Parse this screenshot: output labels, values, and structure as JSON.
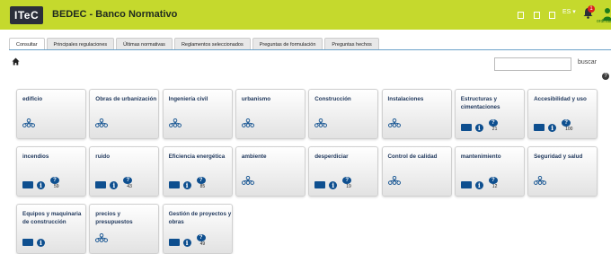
{
  "header": {
    "logo": "ITeC",
    "title": "BEDEC - Banco Normativo",
    "lang": "ES ▾",
    "notifications": "1",
    "user": "ordinatro"
  },
  "tabs": [
    {
      "label": "Consultar",
      "active": true
    },
    {
      "label": "Principales regulaciones",
      "active": false
    },
    {
      "label": "Últimas normativas",
      "active": false
    },
    {
      "label": "Reglamentos seleccionados",
      "active": false
    },
    {
      "label": "Preguntas de formulación",
      "active": false
    },
    {
      "label": "Preguntas hechos",
      "active": false
    }
  ],
  "search": {
    "placeholder": "",
    "button": "buscar"
  },
  "help": "?",
  "cards": [
    {
      "title": "edificio",
      "icons": [
        "network"
      ]
    },
    {
      "title": "Obras de urbanización",
      "icons": [
        "network"
      ]
    },
    {
      "title": "Ingeniería civil",
      "icons": [
        "network"
      ]
    },
    {
      "title": "urbanismo",
      "icons": [
        "network"
      ]
    },
    {
      "title": "Construcción",
      "icons": [
        "network"
      ]
    },
    {
      "title": "Instalaciones",
      "icons": [
        "network"
      ]
    },
    {
      "title": "Estructuras y cimentaciones",
      "icons": [
        "book",
        "info",
        "question"
      ],
      "count": "21"
    },
    {
      "title": "Accesibilidad y uso",
      "icons": [
        "book",
        "info",
        "question"
      ],
      "count": "100"
    },
    {
      "title": "incendios",
      "icons": [
        "book",
        "info",
        "question"
      ],
      "count": "59"
    },
    {
      "title": "ruido",
      "icons": [
        "book",
        "info",
        "question"
      ],
      "count": "43"
    },
    {
      "title": "Eficiencia energética",
      "icons": [
        "book",
        "info",
        "question"
      ],
      "count": "85"
    },
    {
      "title": "ambiente",
      "icons": [
        "network"
      ]
    },
    {
      "title": "desperdiciar",
      "icons": [
        "book",
        "info",
        "question"
      ],
      "count": "19"
    },
    {
      "title": "Control de calidad",
      "icons": [
        "network"
      ]
    },
    {
      "title": "mantenimiento",
      "icons": [
        "book",
        "info",
        "question"
      ],
      "count": "12"
    },
    {
      "title": "Seguridad y salud",
      "icons": [
        "network"
      ]
    },
    {
      "title": "Equipos y maquinaria de construcción",
      "icons": [
        "book",
        "info"
      ]
    },
    {
      "title": "precios y presupuestos",
      "icons": [
        "network"
      ]
    },
    {
      "title": "Gestión de proyectos y obras",
      "icons": [
        "book",
        "info",
        "question"
      ],
      "count": "49"
    }
  ],
  "colors": {
    "topbar": "#c5d92d",
    "logo_bg": "#2b2f3a",
    "icon_blue": "#0e4f8f",
    "title_blue": "#223a5e",
    "badge_red": "#d9201c"
  }
}
